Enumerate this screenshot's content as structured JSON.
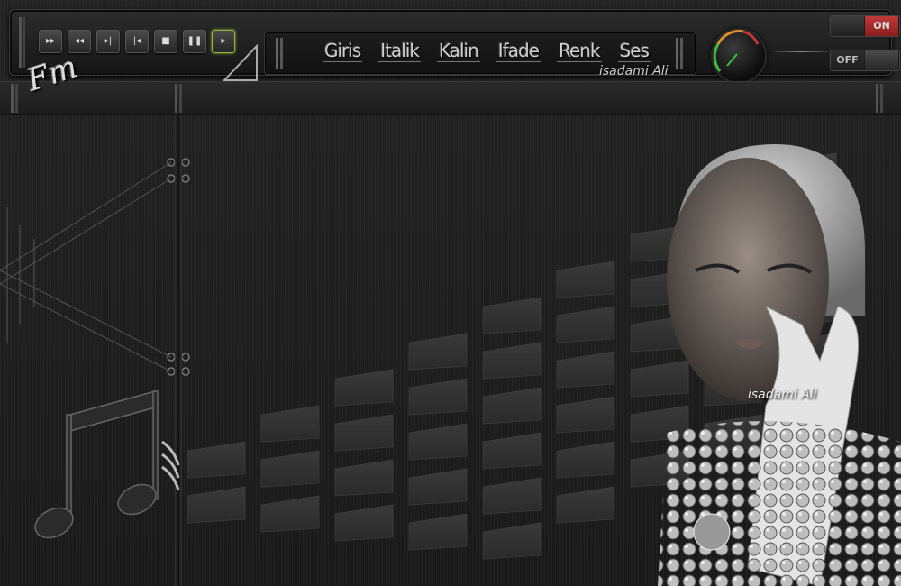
{
  "menu": {
    "items": [
      "Giris",
      "Italik",
      "Kalin",
      "Ifade",
      "Renk",
      "Ses"
    ]
  },
  "signature": "isadami Ali",
  "photo_signature": "isadami Ali",
  "logo_text": "Fm",
  "toggles": {
    "on_label": "ON",
    "off_label": "OFF"
  },
  "player_buttons": [
    {
      "name": "fast-forward",
      "glyph": "▸▸"
    },
    {
      "name": "rewind",
      "glyph": "◂◂"
    },
    {
      "name": "next-track",
      "glyph": "▸|"
    },
    {
      "name": "previous-track",
      "glyph": "|◂"
    },
    {
      "name": "stop",
      "glyph": "■"
    },
    {
      "name": "pause",
      "glyph": "❚❚"
    },
    {
      "name": "play",
      "glyph": "▸"
    }
  ],
  "colors": {
    "accent_green": "#9bb33a",
    "on_red": "#c03a3a",
    "knob_green": "#3fbf3f",
    "knob_orange": "#d9902a"
  }
}
